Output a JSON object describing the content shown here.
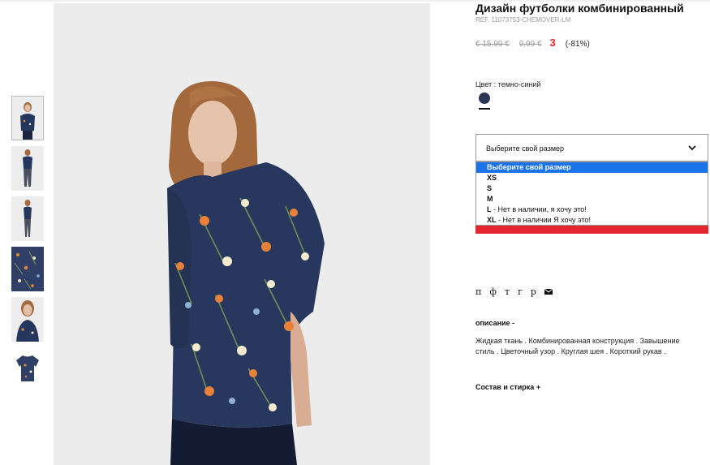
{
  "product": {
    "title": "Дизайн футболки комбинированный",
    "ref": "REF. 11073753-CHEMOVER-LM",
    "price_old1": "€ 15,99 €",
    "price_old2": "9,99 €",
    "price_current": "3",
    "discount": "(-81%)"
  },
  "color": {
    "label": "Цвет : темно-синий",
    "swatch": "#2b3656"
  },
  "size": {
    "select_text": "Выберите свой размер",
    "options": [
      {
        "name": "Выберите свой размер",
        "note": ""
      },
      {
        "name": "XS",
        "note": ""
      },
      {
        "name": "S",
        "note": ""
      },
      {
        "name": "M",
        "note": ""
      },
      {
        "name": "L",
        "note": " - Нет в наличии, я хочу это!"
      },
      {
        "name": "XL",
        "note": " - Нет в наличии Я хочу это!"
      }
    ]
  },
  "social": {
    "icons": [
      "п",
      "ф",
      "т",
      "г",
      "р"
    ],
    "mail_icon": "mail-icon"
  },
  "description": {
    "title": "описание -",
    "text": "Жидкая ткань . Комбинированная конструкция . Завышение стиль . Цветочный узор . Круглая шея . Короткий рукав ."
  },
  "composition": {
    "title": "Состав и стирка +"
  },
  "colors": {
    "accent_red": "#e3262f",
    "selected_option": "#1a73e8",
    "navy": "#2b3656"
  }
}
